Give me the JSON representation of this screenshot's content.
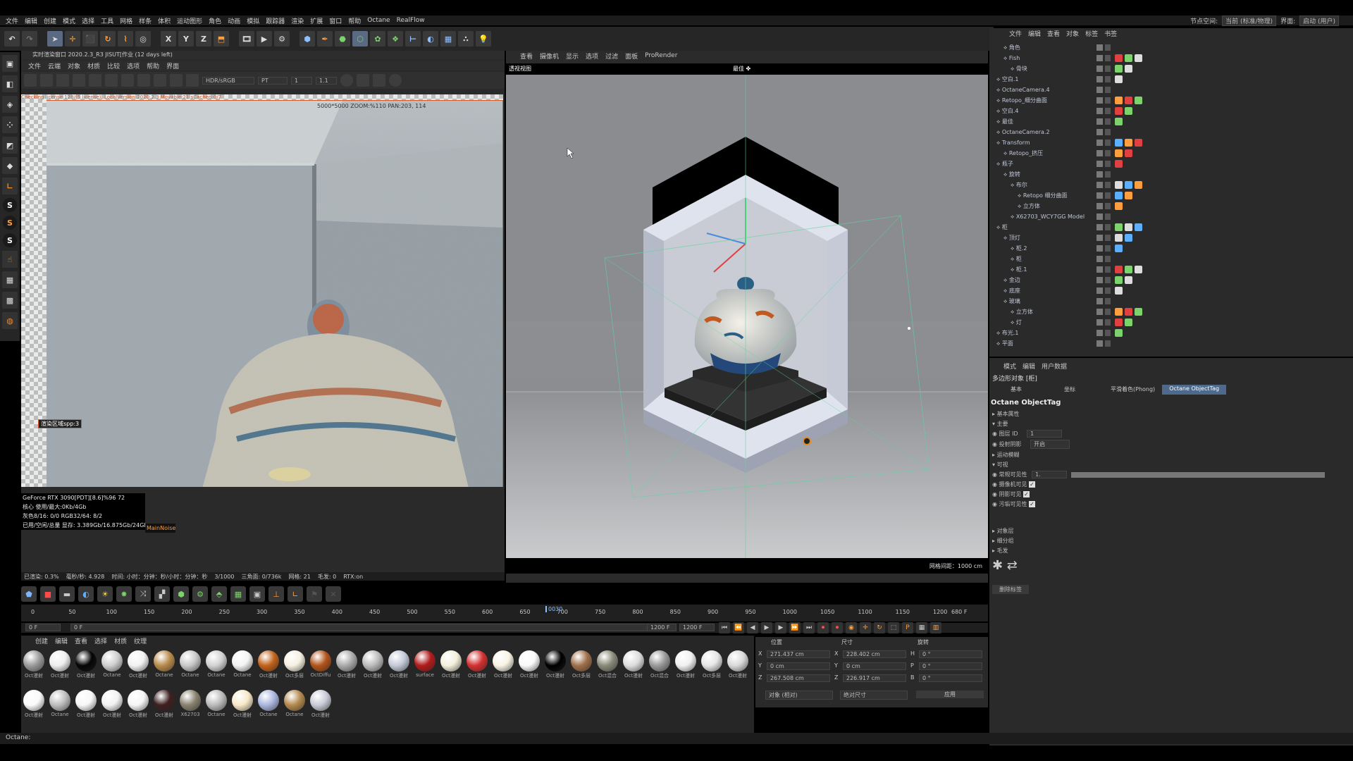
{
  "menubar": {
    "items": [
      "文件",
      "编辑",
      "创建",
      "模式",
      "选择",
      "工具",
      "网格",
      "样条",
      "体积",
      "运动图形",
      "角色",
      "动画",
      "模拟",
      "跟踪器",
      "渲染",
      "扩展",
      "窗口",
      "帮助",
      "Octane",
      "RealFlow"
    ],
    "right_labels": [
      "节点空间:",
      "当前 (标准/物理)",
      "界面:",
      "启动 (用户)"
    ]
  },
  "toolbar": {
    "icons": [
      "undo-icon",
      "redo-icon",
      "select-icon",
      "move-icon",
      "scale-icon",
      "rotate-icon",
      "recent-tool-icon",
      "axis-x",
      "axis-y",
      "axis-z",
      "world-coords-icon",
      "render-region-icon",
      "render-view-icon",
      "render-settings-icon",
      "cube-icon",
      "pen-icon",
      "subdivision-icon",
      "extrude-icon",
      "cloner-icon",
      "deformer-icon",
      "field-icon",
      "camera-icon",
      "floor-icon",
      "hair-icon",
      "light-icon"
    ],
    "axis_labels": [
      "X",
      "Y",
      "Z"
    ]
  },
  "render_viewer": {
    "title": "实时渲染窗口 2020.2.3_R3 JISUT[作业 (12 days left)",
    "menu": [
      "文件",
      "云端",
      "对象",
      "材质",
      "比较",
      "选项",
      "帮助",
      "界面"
    ],
    "mode_select": "HDR/sRGB",
    "pass_select": "PT",
    "field_a": "1",
    "field_b": "1.1",
    "zoom_info": "5000*5000 ZOOM:%110 PAN:203, 114",
    "region_label": "渲染区域spp:3",
    "overlay_text": "Checking license 128/(5 license), LocalVersion:2020.2.3 Movable:21 sCached:0/7",
    "stats": [
      "GeForce RTX 3090[PDT][8.6]%96    72",
      "核心 使用/最大:0Kb/4Gb",
      "灰色8/16: 0/0          RGB32/64: 8/2",
      "已用/空闲/总量 显存: 3.389Gb/16.875Gb/24Gb"
    ],
    "stat_badge": "MainNoise",
    "statusbar": [
      "已渲染: 0.3%",
      "毫秒/秒: 4.928",
      "时间: 小时：分钟：秒/小时：分钟：秒",
      "3/1000",
      "三角面: 0/736k",
      "网格: 21",
      "毛发: 0",
      "RTX:on"
    ]
  },
  "viewport": {
    "menu": [
      "查看",
      "摄像机",
      "显示",
      "选项",
      "过滤",
      "面板",
      "ProRender"
    ],
    "label": "透视视图",
    "camera": "最佳 ✤",
    "grid_spacing": "网格间距：1000 cm"
  },
  "object_manager": {
    "menu": [
      "文件",
      "编辑",
      "查看",
      "对象",
      "标签",
      "书签"
    ],
    "rows": [
      {
        "name": "角色",
        "indent": 1
      },
      {
        "name": "Fish",
        "indent": 1
      },
      {
        "name": "骨块",
        "indent": 2
      },
      {
        "name": "空白.1",
        "indent": 0
      },
      {
        "name": "OctaneCamera.4",
        "indent": 0
      },
      {
        "name": "Retopo_细分曲面",
        "indent": 0
      },
      {
        "name": "空白.4",
        "indent": 0
      },
      {
        "name": "最佳",
        "indent": 0
      },
      {
        "name": "OctaneCamera.2",
        "indent": 0
      },
      {
        "name": "Transform",
        "indent": 0
      },
      {
        "name": "Retopo_挤压",
        "indent": 1
      },
      {
        "name": "瓶子",
        "indent": 0
      },
      {
        "name": "旋转",
        "indent": 1
      },
      {
        "name": "布尔",
        "indent": 2
      },
      {
        "name": "Retopo 细分曲面",
        "indent": 3
      },
      {
        "name": "立方体",
        "indent": 3
      },
      {
        "name": "X62703_WCY7GG Model",
        "indent": 2
      },
      {
        "name": "柜",
        "indent": 0
      },
      {
        "name": "顶灯",
        "indent": 1
      },
      {
        "name": "柜.2",
        "indent": 2
      },
      {
        "name": "柜",
        "indent": 2
      },
      {
        "name": "柜.1",
        "indent": 2
      },
      {
        "name": "金边",
        "indent": 1
      },
      {
        "name": "底座",
        "indent": 1
      },
      {
        "name": "玻璃",
        "indent": 1
      },
      {
        "name": "立方体",
        "indent": 2
      },
      {
        "name": "灯",
        "indent": 2
      },
      {
        "name": "布光.1",
        "indent": 0
      },
      {
        "name": "平面",
        "indent": 0
      }
    ]
  },
  "attributes": {
    "menu": [
      "模式",
      "编辑",
      "用户数据"
    ],
    "object": "多边形对象 [柜]",
    "tabs": [
      "基本",
      "坐标",
      "平滑着色(Phong)",
      "Octane ObjectTag"
    ],
    "active_tab": "Octane ObjectTag",
    "title": "Octane ObjectTag",
    "sections": [
      "基本属性",
      "主要",
      "运动模糊",
      "可视",
      "对象层",
      "细分组",
      "毛发"
    ],
    "fields": [
      {
        "label": "图层 ID",
        "value": "1"
      },
      {
        "label": "投射阴影",
        "value": "开启"
      },
      {
        "label": "常规可见性",
        "value": "1."
      },
      {
        "label": "摄像机可见",
        "value": "✓"
      },
      {
        "label": "阴影可见",
        "value": "✓"
      },
      {
        "label": "污垢可见性",
        "value": "✓"
      }
    ],
    "button": "删除标签"
  },
  "coordinates": {
    "headers": [
      "位置",
      "尺寸",
      "旋转"
    ],
    "rows": [
      {
        "axis": "X",
        "pos": "271.437 cm",
        "size_axis": "X",
        "size": "228.402 cm",
        "rot_axis": "H",
        "rot": "0 °"
      },
      {
        "axis": "Y",
        "pos": "0 cm",
        "size_axis": "Y",
        "size": "0 cm",
        "rot_axis": "P",
        "rot": "0 °"
      },
      {
        "axis": "Z",
        "pos": "267.508 cm",
        "size_axis": "Z",
        "size": "226.917 cm",
        "rot_axis": "B",
        "rot": "0 °"
      }
    ],
    "mode_a": "对象 (相对)",
    "mode_b": "绝对尺寸",
    "apply": "应用"
  },
  "timeline": {
    "ticks": [
      "0",
      "50",
      "100",
      "150",
      "200",
      "250",
      "300",
      "350",
      "400",
      "450",
      "500",
      "550",
      "600",
      "650",
      "700",
      "750",
      "800",
      "850",
      "900",
      "950",
      "1000",
      "1050",
      "1100",
      "1150",
      "1200"
    ],
    "marker": "0030",
    "end_label": "680 F",
    "start_field": "0 F",
    "current_field": "0 F",
    "end_field": "1200 F",
    "end_field2": "1200 F"
  },
  "materials": {
    "menu": [
      "创建",
      "编辑",
      "查看",
      "选择",
      "材质",
      "纹理"
    ],
    "items": [
      {
        "label": "Oct漫射",
        "color": "#9a9a9a"
      },
      {
        "label": "Oct漫射",
        "color": "#eeeeee"
      },
      {
        "label": "Oct漫射",
        "color": "#050505"
      },
      {
        "label": "Octane",
        "color": "#cfcfcf"
      },
      {
        "label": "Oct漫射",
        "color": "#f2f2f2"
      },
      {
        "label": "Octane",
        "color": "#b88b4a"
      },
      {
        "label": "Octane",
        "color": "#c8c8c8"
      },
      {
        "label": "Octane",
        "color": "#d2d2d2"
      },
      {
        "label": "Octane",
        "color": "#f4f4f4"
      },
      {
        "label": "Oct漫射",
        "color": "#c2621a"
      },
      {
        "label": "Oct多层",
        "color": "#f5f0e0"
      },
      {
        "label": "OctDiffu",
        "color": "#b3541a"
      },
      {
        "label": "Oct漫射",
        "color": "#aaaaaa"
      },
      {
        "label": "Oct漫射",
        "color": "#bbbbbb"
      },
      {
        "label": "Oct漫射",
        "color": "#c4c9d8"
      },
      {
        "label": "surface",
        "color": "#b21b1b"
      },
      {
        "label": "Oct漫射",
        "color": "#f4f0dc"
      },
      {
        "label": "Oct漫射",
        "color": "#d53030"
      },
      {
        "label": "Oct漫射",
        "color": "#f8f3e3"
      },
      {
        "label": "Oct漫射",
        "color": "#f8f8f8"
      },
      {
        "label": "Oct漫射",
        "color": "#000000"
      },
      {
        "label": "Oct多层",
        "color": "#a0704a"
      },
      {
        "label": "Oct混合",
        "color": "#8a8a7a"
      },
      {
        "label": "Oct漫射",
        "color": "#dddddd"
      },
      {
        "label": "Oct混合",
        "color": "#999999"
      },
      {
        "label": "Oct漫射",
        "color": "#f0f0f0"
      },
      {
        "label": "Oct多层",
        "color": "#e6e6e6"
      },
      {
        "label": "Oct漫射",
        "color": "#d9d9d9"
      },
      {
        "label": "Oct漫射",
        "color": "#fafafa"
      },
      {
        "label": "Octane",
        "color": "#bdbdbd"
      },
      {
        "label": "Oct漫射",
        "color": "#f7f7f7"
      },
      {
        "label": "Oct漫射",
        "color": "#f2f2f2"
      },
      {
        "label": "Oct漫射",
        "color": "#f5f5f5"
      },
      {
        "label": "Oct漫射",
        "color": "#3e2020"
      },
      {
        "label": "X62703",
        "color": "#8a8270"
      },
      {
        "label": "Octane",
        "color": "#bbbbbb"
      },
      {
        "label": "Oct漫射",
        "color": "#f8e8c8"
      },
      {
        "label": "Octane",
        "color": "#aab6dd"
      },
      {
        "label": "Octane",
        "color": "#b48a4e"
      },
      {
        "label": "Oct漫射",
        "color": "#c8cbd6"
      }
    ]
  },
  "statusbar": "Octane:",
  "colors": {
    "accent": "#4d6a8c",
    "render_border": "#d35a2a",
    "highlight_orange": "#ff9e3d"
  }
}
